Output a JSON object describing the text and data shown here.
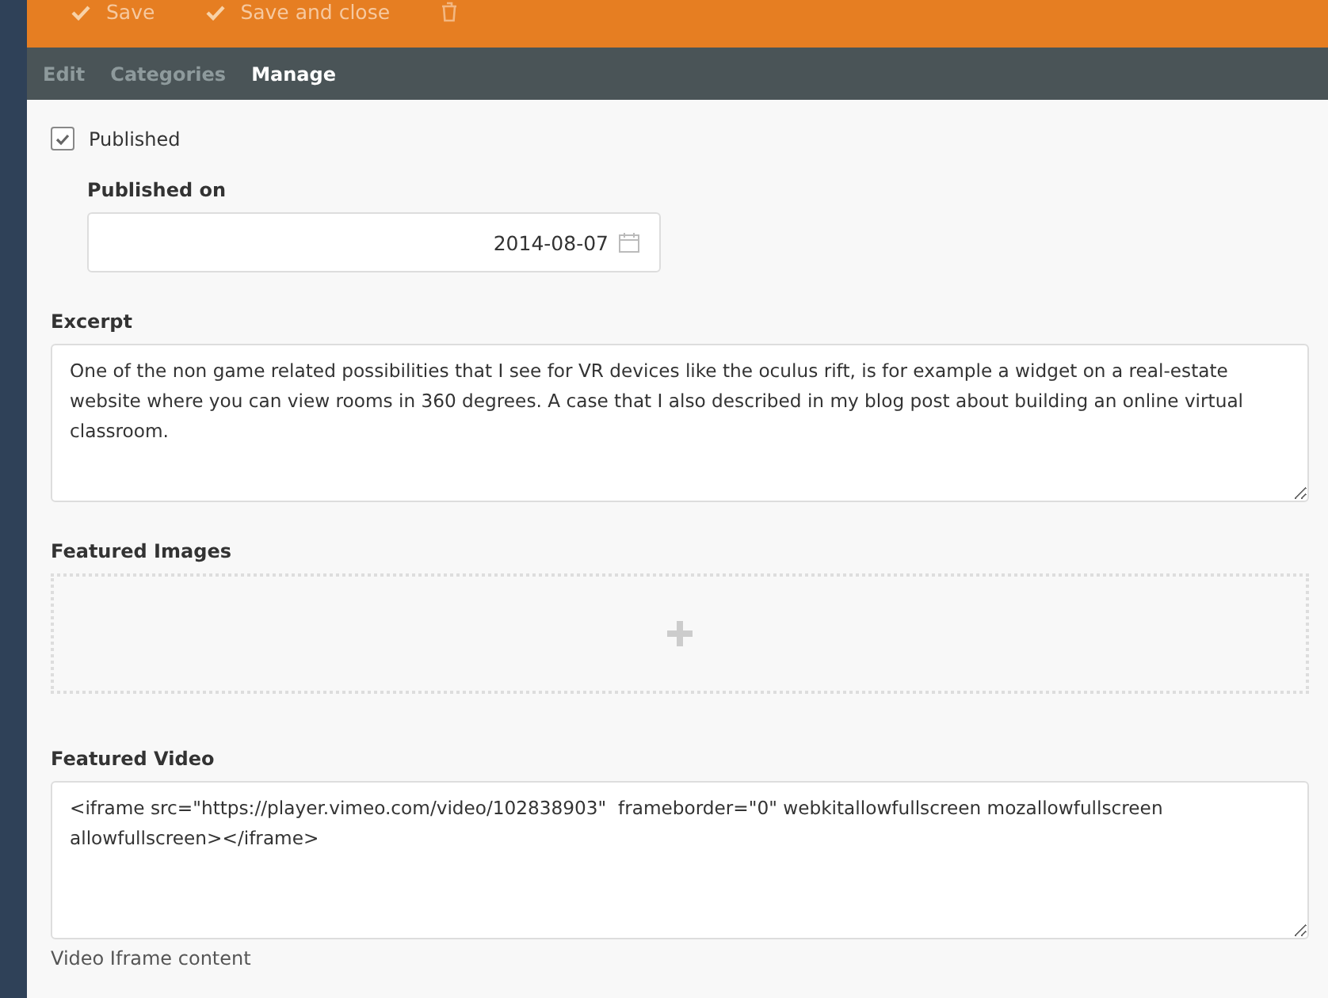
{
  "toolbar": {
    "buttons": [
      {
        "kind": "check",
        "label": "Save"
      },
      {
        "kind": "check",
        "label": "Save and close"
      },
      {
        "kind": "trash"
      }
    ]
  },
  "tabs": [
    {
      "label": "Edit",
      "selected": false
    },
    {
      "label": "Categories",
      "selected": false
    },
    {
      "label": "Manage",
      "selected": true
    }
  ],
  "published": {
    "label": "Published",
    "checked": true
  },
  "published_on": {
    "label": "Published on",
    "value": "2014-08-07"
  },
  "excerpt": {
    "label": "Excerpt",
    "value": "One of the non game related possibilities that I see for VR devices like the oculus rift, is for example a widget on a real-estate website where you can view rooms in 360 degrees. A case that I also described in my blog post about building an online virtual classroom."
  },
  "featured_images": {
    "label": "Featured Images"
  },
  "featured_video": {
    "label": "Featured Video",
    "value": "<iframe src=\"https://player.vimeo.com/video/102838903\"  frameborder=\"0\" webkitallowfullscreen mozallowfullscreen allowfullscreen></iframe>",
    "help": "Video Iframe content"
  }
}
